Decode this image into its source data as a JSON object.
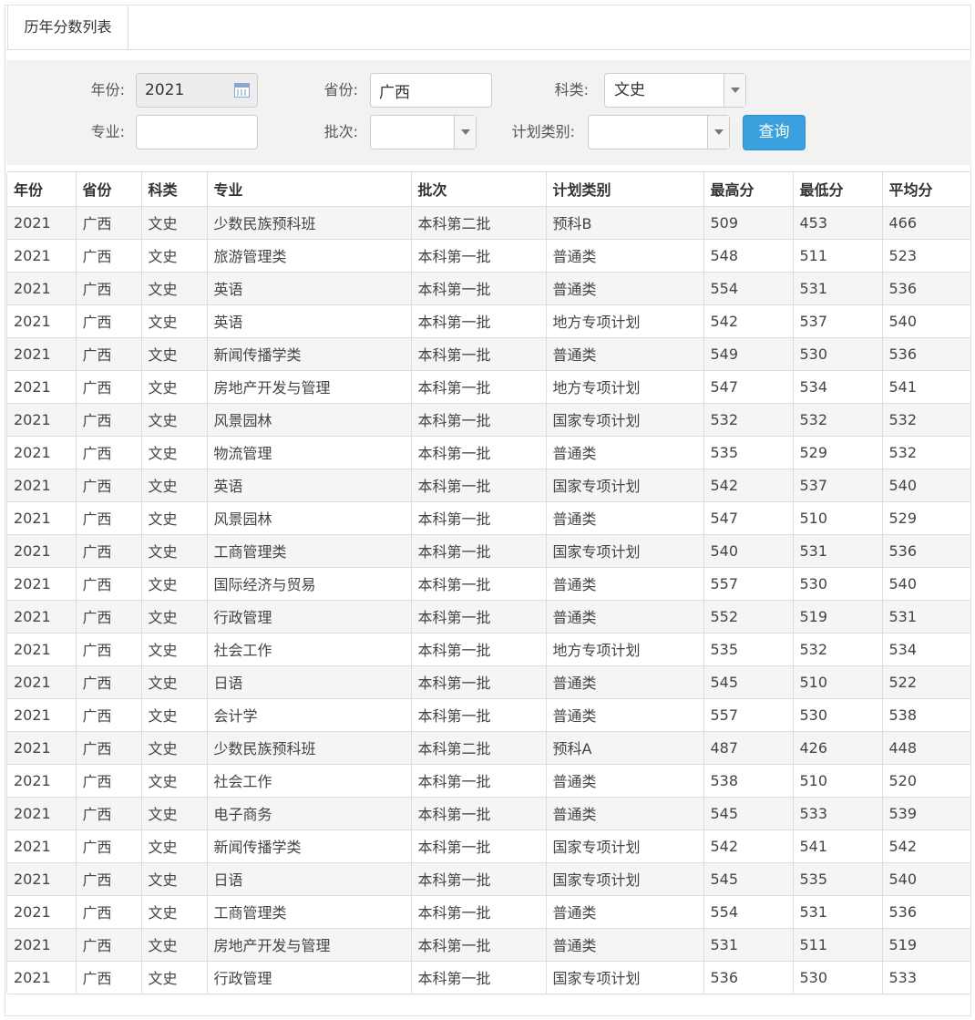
{
  "tab": {
    "label": "历年分数列表"
  },
  "filters": {
    "year_label": "年份:",
    "year_value": "2021",
    "province_label": "省份:",
    "province_value": "广西",
    "category_label": "科类:",
    "category_value": "文史",
    "major_label": "专业:",
    "major_value": "",
    "batch_label": "批次:",
    "batch_value": "",
    "plan_label": "计划类别:",
    "plan_value": "",
    "search_button": "查询"
  },
  "table": {
    "headers": [
      "年份",
      "省份",
      "科类",
      "专业",
      "批次",
      "计划类别",
      "最高分",
      "最低分",
      "平均分"
    ],
    "rows": [
      [
        "2021",
        "广西",
        "文史",
        "少数民族预科班",
        "本科第二批",
        "预科B",
        "509",
        "453",
        "466"
      ],
      [
        "2021",
        "广西",
        "文史",
        "旅游管理类",
        "本科第一批",
        "普通类",
        "548",
        "511",
        "523"
      ],
      [
        "2021",
        "广西",
        "文史",
        "英语",
        "本科第一批",
        "普通类",
        "554",
        "531",
        "536"
      ],
      [
        "2021",
        "广西",
        "文史",
        "英语",
        "本科第一批",
        "地方专项计划",
        "542",
        "537",
        "540"
      ],
      [
        "2021",
        "广西",
        "文史",
        "新闻传播学类",
        "本科第一批",
        "普通类",
        "549",
        "530",
        "536"
      ],
      [
        "2021",
        "广西",
        "文史",
        "房地产开发与管理",
        "本科第一批",
        "地方专项计划",
        "547",
        "534",
        "541"
      ],
      [
        "2021",
        "广西",
        "文史",
        "风景园林",
        "本科第一批",
        "国家专项计划",
        "532",
        "532",
        "532"
      ],
      [
        "2021",
        "广西",
        "文史",
        "物流管理",
        "本科第一批",
        "普通类",
        "535",
        "529",
        "532"
      ],
      [
        "2021",
        "广西",
        "文史",
        "英语",
        "本科第一批",
        "国家专项计划",
        "542",
        "537",
        "540"
      ],
      [
        "2021",
        "广西",
        "文史",
        "风景园林",
        "本科第一批",
        "普通类",
        "547",
        "510",
        "529"
      ],
      [
        "2021",
        "广西",
        "文史",
        "工商管理类",
        "本科第一批",
        "国家专项计划",
        "540",
        "531",
        "536"
      ],
      [
        "2021",
        "广西",
        "文史",
        "国际经济与贸易",
        "本科第一批",
        "普通类",
        "557",
        "530",
        "540"
      ],
      [
        "2021",
        "广西",
        "文史",
        "行政管理",
        "本科第一批",
        "普通类",
        "552",
        "519",
        "531"
      ],
      [
        "2021",
        "广西",
        "文史",
        "社会工作",
        "本科第一批",
        "地方专项计划",
        "535",
        "532",
        "534"
      ],
      [
        "2021",
        "广西",
        "文史",
        "日语",
        "本科第一批",
        "普通类",
        "545",
        "510",
        "522"
      ],
      [
        "2021",
        "广西",
        "文史",
        "会计学",
        "本科第一批",
        "普通类",
        "557",
        "530",
        "538"
      ],
      [
        "2021",
        "广西",
        "文史",
        "少数民族预科班",
        "本科第二批",
        "预科A",
        "487",
        "426",
        "448"
      ],
      [
        "2021",
        "广西",
        "文史",
        "社会工作",
        "本科第一批",
        "普通类",
        "538",
        "510",
        "520"
      ],
      [
        "2021",
        "广西",
        "文史",
        "电子商务",
        "本科第一批",
        "普通类",
        "545",
        "533",
        "539"
      ],
      [
        "2021",
        "广西",
        "文史",
        "新闻传播学类",
        "本科第一批",
        "国家专项计划",
        "542",
        "541",
        "542"
      ],
      [
        "2021",
        "广西",
        "文史",
        "日语",
        "本科第一批",
        "国家专项计划",
        "545",
        "535",
        "540"
      ],
      [
        "2021",
        "广西",
        "文史",
        "工商管理类",
        "本科第一批",
        "普通类",
        "554",
        "531",
        "536"
      ],
      [
        "2021",
        "广西",
        "文史",
        "房地产开发与管理",
        "本科第一批",
        "普通类",
        "531",
        "511",
        "519"
      ],
      [
        "2021",
        "广西",
        "文史",
        "行政管理",
        "本科第一批",
        "国家专项计划",
        "536",
        "530",
        "533"
      ]
    ]
  }
}
